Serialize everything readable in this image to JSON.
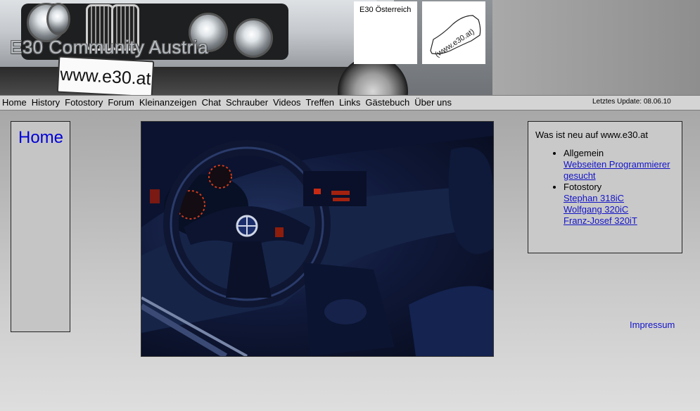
{
  "header": {
    "site_title": "E30 Community Austria",
    "plate_text": "www.e30.at",
    "logo1_text": "E30 Österreich",
    "logo2_text": "(www.e30.at)"
  },
  "nav": {
    "items": [
      "Home",
      "History",
      "Fotostory",
      "Forum",
      "Kleinanzeigen",
      "Chat",
      "Schrauber",
      "Videos",
      "Treffen",
      "Links",
      "Gästebuch",
      "Über uns"
    ],
    "last_update": "Letztes Update: 08.06.10"
  },
  "left": {
    "title": "Home"
  },
  "news": {
    "heading": "Was ist neu auf www.e30.at",
    "sections": [
      {
        "label": "Allgemein",
        "links": [
          "Webseiten Programmierer gesucht"
        ]
      },
      {
        "label": "Fotostory",
        "links": [
          "Stephan 318iC",
          "Wolfgang 320iC",
          "Franz-Josef 320iT"
        ]
      }
    ]
  },
  "footer": {
    "impressum": "Impressum"
  },
  "colors": {
    "link": "#1414c8",
    "title_link": "#0000d8",
    "nav_bg": "#d4d4d4",
    "box_bg": "#c9c9c9"
  }
}
